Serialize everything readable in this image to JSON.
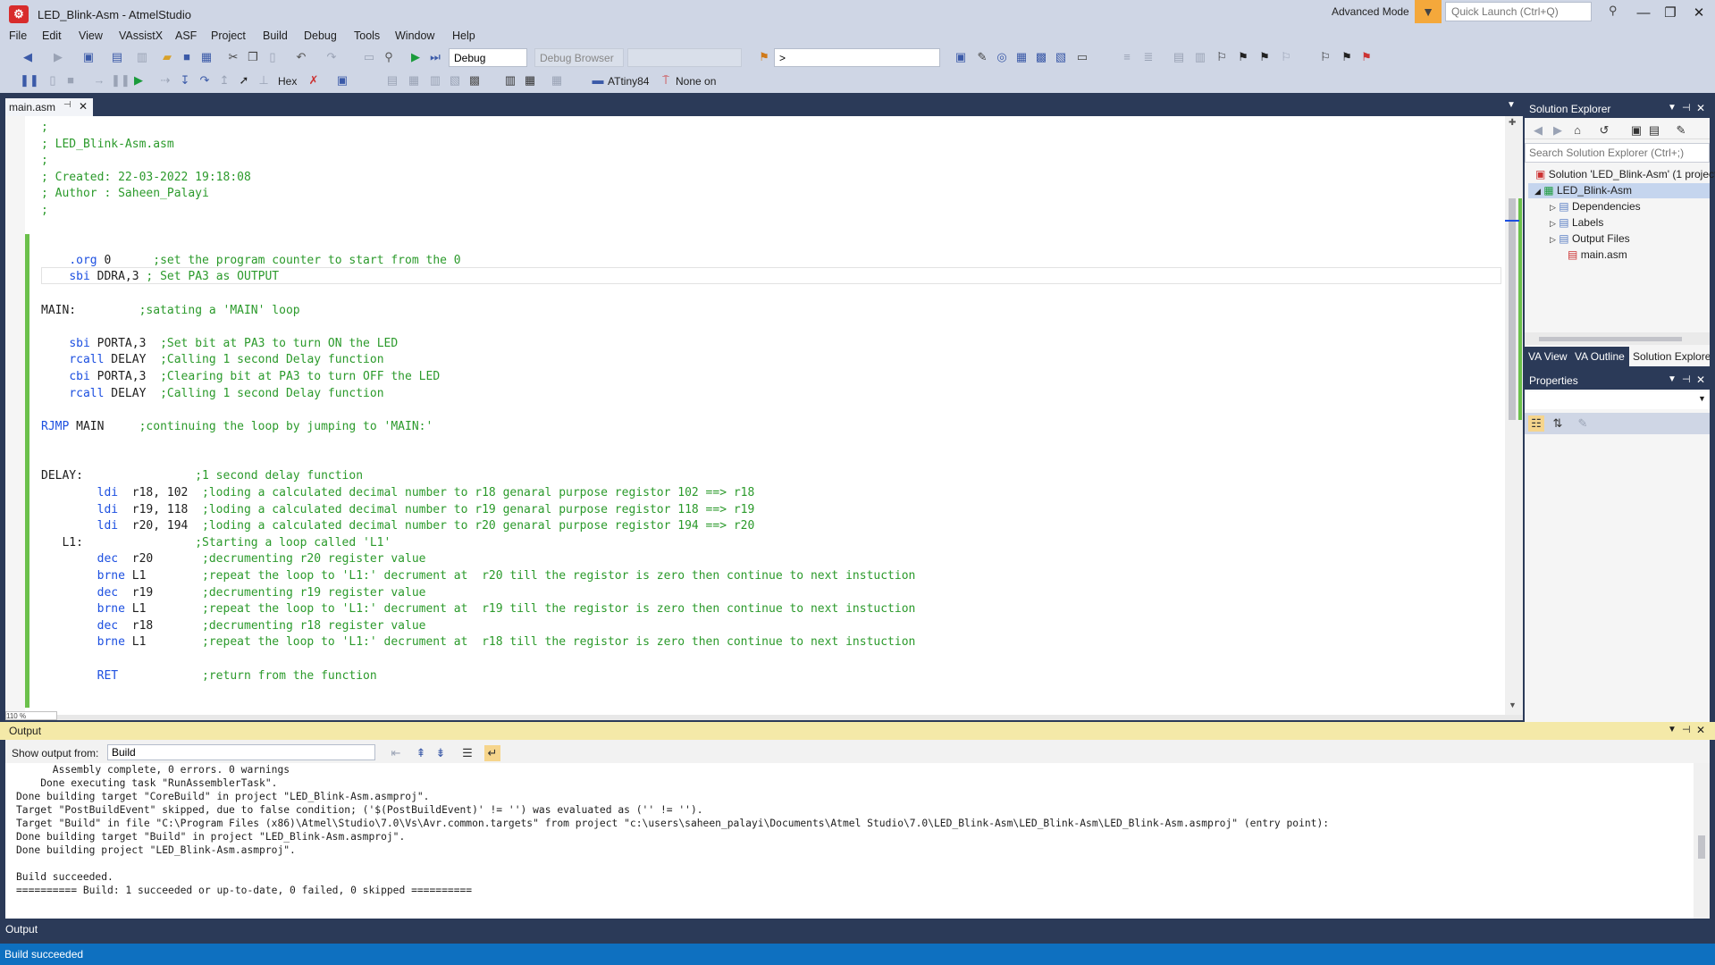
{
  "window": {
    "title": "LED_Blink-Asm - AtmelStudio",
    "mode": "Advanced Mode",
    "quick_launch_placeholder": "Quick Launch (Ctrl+Q)",
    "buttons": [
      "—",
      "❐",
      "✕"
    ]
  },
  "menu": [
    "File",
    "Edit",
    "View",
    "VAssistX",
    "ASF",
    "Project",
    "Build",
    "Debug",
    "Tools",
    "Window",
    "Help"
  ],
  "toolbar1": {
    "config": "Debug",
    "browser": "Debug Browser",
    "platform": "",
    "find": ">"
  },
  "toolbar2": {
    "hex_label": "Hex",
    "device": "ATtiny84",
    "tool": "None on"
  },
  "doc_tab": {
    "name": "main.asm"
  },
  "code_lines": [
    {
      "c": ";"
    },
    {
      "c": "; LED_Blink-Asm.asm"
    },
    {
      "c": ";"
    },
    {
      "c": "; Created: 22-03-2022 19:18:08"
    },
    {
      "c": "; Author : Saheen_Palayi"
    },
    {
      "c": ";"
    },
    {},
    {},
    {
      "p": "    ",
      "k": ".org",
      "r": " 0      ",
      "c": ";set the program counter to start from the 0"
    },
    {
      "p": "    ",
      "k": "sbi",
      "r": " DDRA,3 ",
      "c": "; Set PA3 as OUTPUT"
    },
    {},
    {
      "r": "MAIN:         ",
      "c": ";satating a 'MAIN' loop"
    },
    {},
    {
      "p": "    ",
      "k": "sbi",
      "r": " PORTA,3  ",
      "c": ";Set bit at PA3 to turn ON the LED"
    },
    {
      "p": "    ",
      "k": "rcall",
      "r": " DELAY  ",
      "c": ";Calling 1 second Delay function"
    },
    {
      "p": "    ",
      "k": "cbi",
      "r": " PORTA,3  ",
      "c": ";Clearing bit at PA3 to turn OFF the LED"
    },
    {
      "p": "    ",
      "k": "rcall",
      "r": " DELAY  ",
      "c": ";Calling 1 second Delay function"
    },
    {},
    {
      "k": "RJMP",
      "r": " MAIN     ",
      "c": ";continuing the loop by jumping to 'MAIN:'"
    },
    {},
    {},
    {
      "r": "DELAY:                ",
      "c": ";1 second delay function"
    },
    {
      "p": "        ",
      "k": "ldi",
      "r": "  r18, 102  ",
      "c": ";loding a calculated decimal number to r18 genaral purpose registor 102 ==> r18"
    },
    {
      "p": "        ",
      "k": "ldi",
      "r": "  r19, 118  ",
      "c": ";loding a calculated decimal number to r19 genaral purpose registor 118 ==> r19"
    },
    {
      "p": "        ",
      "k": "ldi",
      "r": "  r20, 194  ",
      "c": ";loding a calculated decimal number to r20 genaral purpose registor 194 ==> r20"
    },
    {
      "r": "   L1:                ",
      "c": ";Starting a loop called 'L1'"
    },
    {
      "p": "        ",
      "k": "dec",
      "r": "  r20       ",
      "c": ";decrumenting r20 register value"
    },
    {
      "p": "        ",
      "k": "brne",
      "r": " L1        ",
      "c": ";repeat the loop to 'L1:' decrument at  r20 till the registor is zero then continue to next instuction"
    },
    {
      "p": "        ",
      "k": "dec",
      "r": "  r19       ",
      "c": ";decrumenting r19 register value"
    },
    {
      "p": "        ",
      "k": "brne",
      "r": " L1        ",
      "c": ";repeat the loop to 'L1:' decrument at  r19 till the registor is zero then continue to next instuction"
    },
    {
      "p": "        ",
      "k": "dec",
      "r": "  r18       ",
      "c": ";decrumenting r18 register value"
    },
    {
      "p": "        ",
      "k": "brne",
      "r": " L1        ",
      "c": ";repeat the loop to 'L1:' decrument at  r18 till the registor is zero then continue to next instuction"
    },
    {},
    {
      "p": "        ",
      "k": "RET",
      "r": "            ",
      "c": ";return from the function"
    }
  ],
  "editor": {
    "zoom": "110 %"
  },
  "solution_explorer": {
    "title": "Solution Explorer",
    "search_placeholder": "Search Solution Explorer (Ctrl+;)",
    "solution": "Solution 'LED_Blink-Asm' (1 project)",
    "project": "LED_Blink-Asm",
    "items": [
      "Dependencies",
      "Labels",
      "Output Files",
      "main.asm"
    ],
    "tabs": [
      "VA View",
      "VA Outline",
      "Solution Explorer"
    ]
  },
  "properties": {
    "title": "Properties"
  },
  "output": {
    "title": "Output",
    "show_from_label": "Show output from:",
    "source": "Build",
    "lines": [
      "      Assembly complete, 0 errors. 0 warnings",
      "    Done executing task \"RunAssemblerTask\".",
      "Done building target \"CoreBuild\" in project \"LED_Blink-Asm.asmproj\".",
      "Target \"PostBuildEvent\" skipped, due to false condition; ('$(PostBuildEvent)' != '') was evaluated as ('' != '').",
      "Target \"Build\" in file \"C:\\Program Files (x86)\\Atmel\\Studio\\7.0\\Vs\\Avr.common.targets\" from project \"c:\\users\\saheen_palayi\\Documents\\Atmel Studio\\7.0\\LED_Blink-Asm\\LED_Blink-Asm\\LED_Blink-Asm.asmproj\" (entry point):",
      "Done building target \"Build\" in project \"LED_Blink-Asm.asmproj\".",
      "Done building project \"LED_Blink-Asm.asmproj\".",
      "",
      "Build succeeded.",
      "========== Build: 1 succeeded or up-to-date, 0 failed, 0 skipped =========="
    ],
    "bottom_tab": "Output"
  },
  "status": {
    "text": "Build succeeded"
  }
}
